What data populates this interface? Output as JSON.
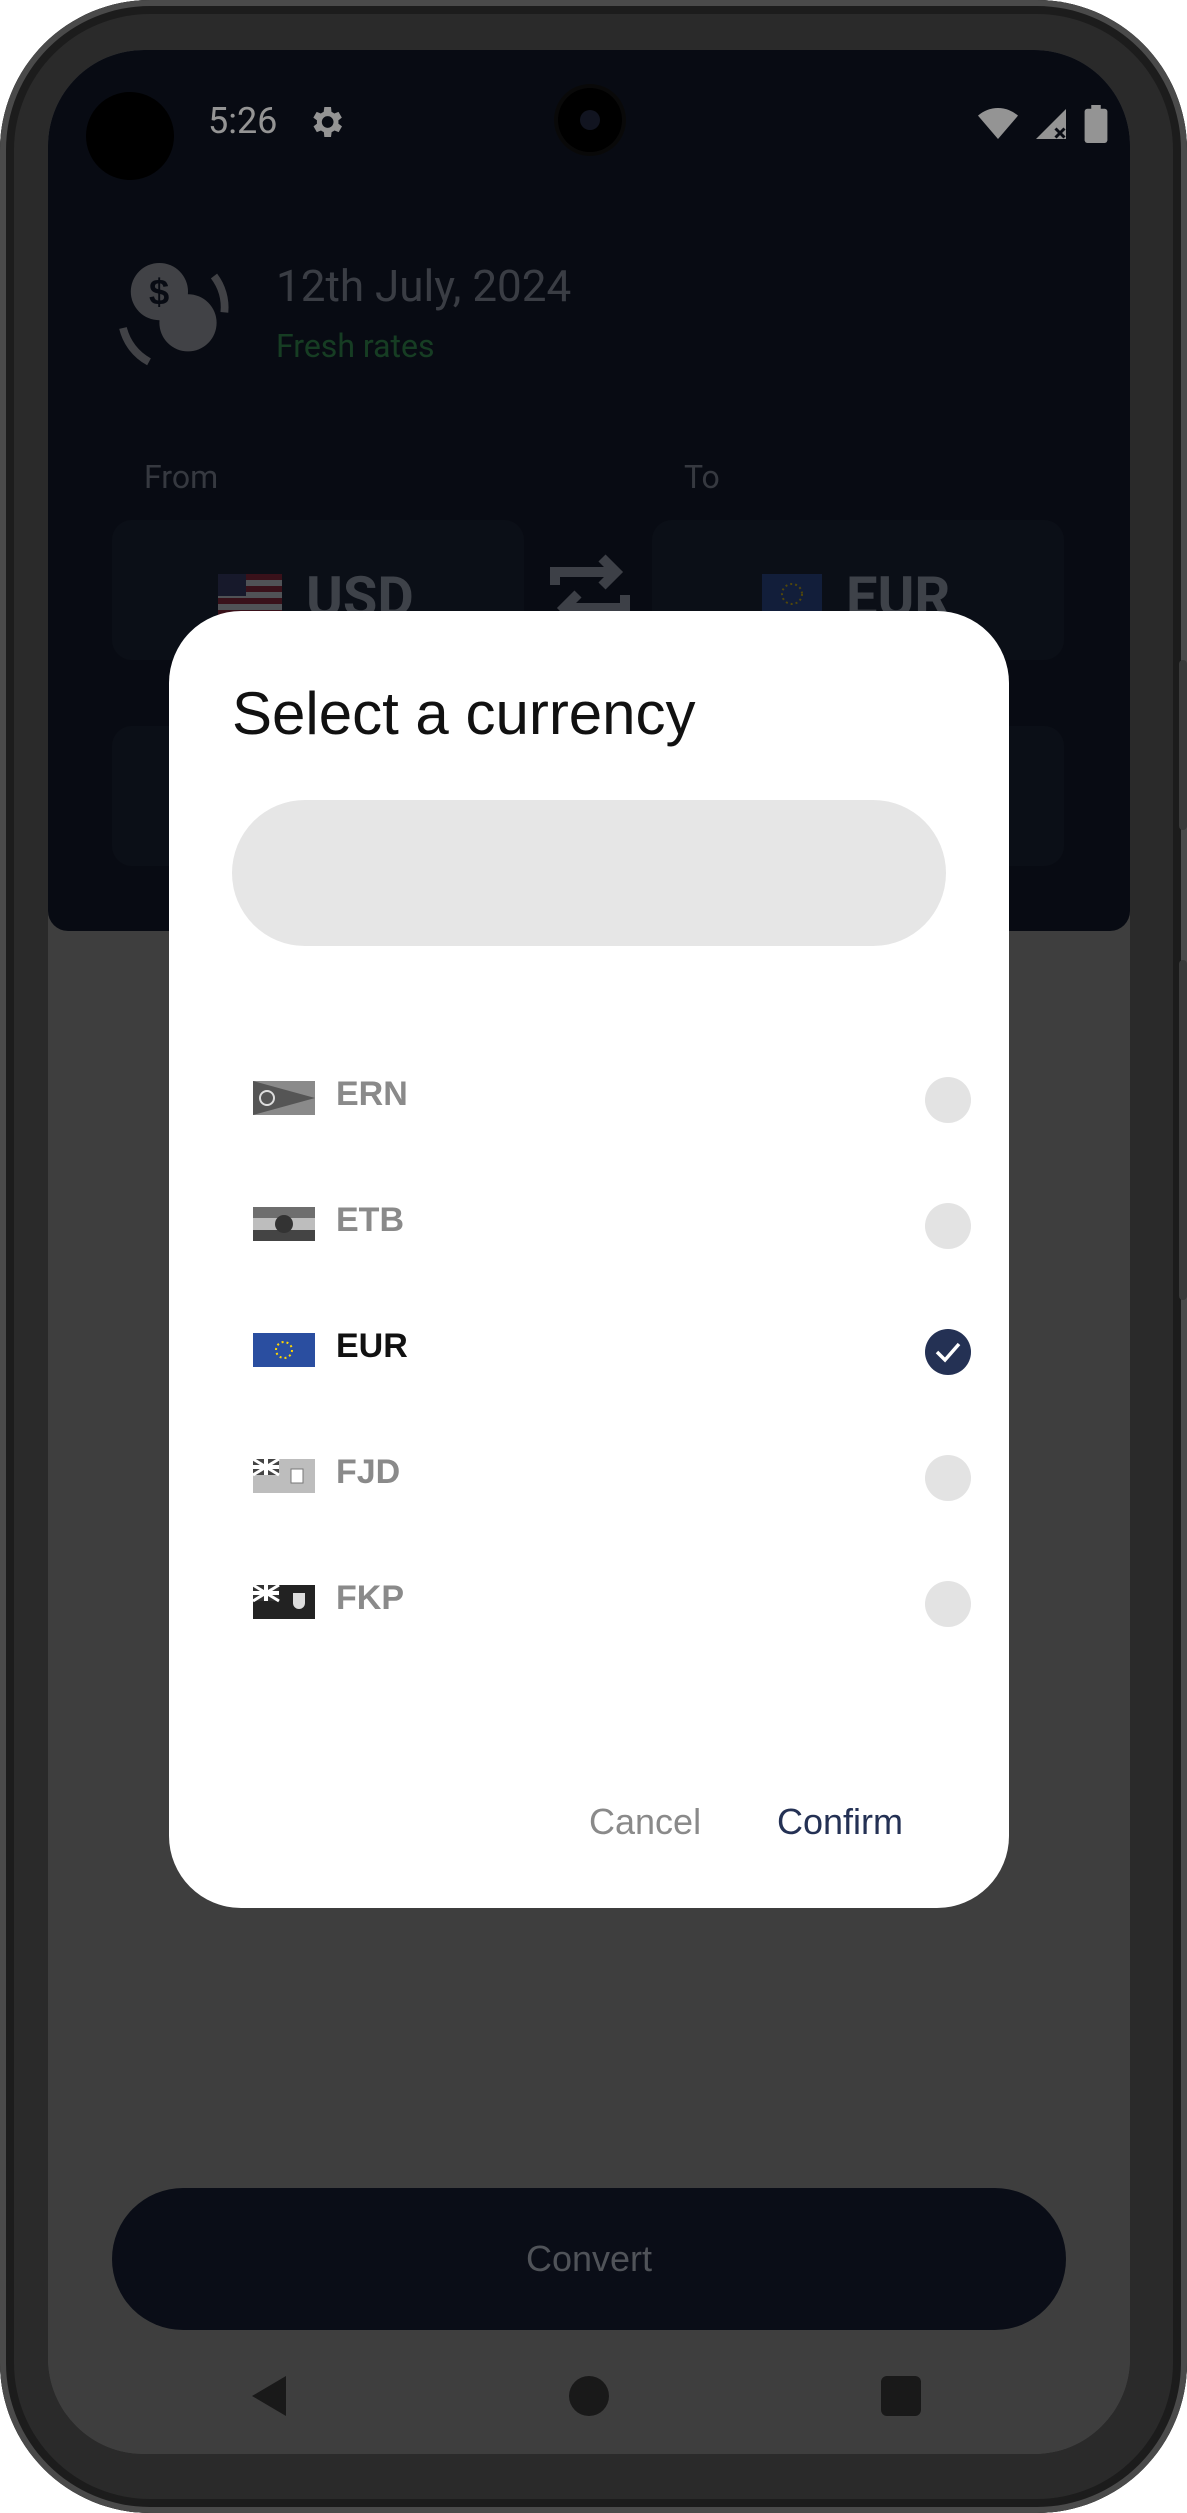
{
  "status_bar": {
    "time": "5:26"
  },
  "header": {
    "date": "12th July, 2024",
    "freshness": "Fresh rates",
    "from_label": "From",
    "to_label": "To",
    "from_currency": "USD",
    "to_currency": "EUR"
  },
  "dialog": {
    "title": "Select a currency",
    "search_placeholder": "",
    "items": [
      {
        "code": "ERN",
        "selected": false
      },
      {
        "code": "ETB",
        "selected": false
      },
      {
        "code": "EUR",
        "selected": true
      },
      {
        "code": "FJD",
        "selected": false
      },
      {
        "code": "FKP",
        "selected": false
      }
    ],
    "cancel_label": "Cancel",
    "confirm_label": "Confirm"
  },
  "convert_button": {
    "label": "Convert"
  },
  "colors": {
    "accent": "#243154",
    "header_bg": "#0f1421",
    "fresh_green": "#3fbf5a"
  },
  "icons": [
    "settings-gear-icon",
    "wifi-icon",
    "signal-icon",
    "battery-icon",
    "currency-exchange-icon",
    "swap-icon",
    "check-icon",
    "back-icon",
    "home-icon",
    "recents-icon"
  ]
}
